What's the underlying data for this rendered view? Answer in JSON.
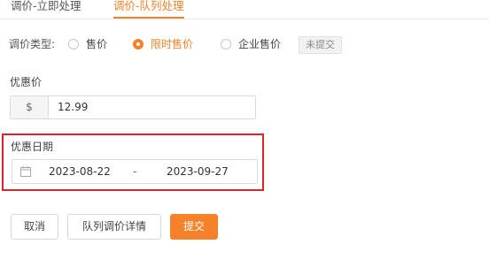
{
  "tabs": [
    {
      "label": "调价-立即处理",
      "active": false
    },
    {
      "label": "调价-队列处理",
      "active": true
    }
  ],
  "price_type": {
    "label": "调价类型:",
    "options": [
      {
        "label": "售价",
        "checked": false
      },
      {
        "label": "限时售价",
        "checked": true
      },
      {
        "label": "企业售价",
        "checked": false
      }
    ],
    "status_badge": "未提交"
  },
  "discount_price": {
    "label": "优惠价",
    "currency_symbol": "$",
    "value": "12.99"
  },
  "discount_date": {
    "label": "优惠日期",
    "start": "2023-08-22",
    "separator": "-",
    "end": "2023-09-27"
  },
  "actions": {
    "cancel": "取消",
    "queue_details": "队列调价详情",
    "submit": "提交"
  },
  "colors": {
    "accent": "#f5822a",
    "highlight_border": "#d9252a"
  },
  "icons": {
    "date_field": "calendar-icon"
  }
}
